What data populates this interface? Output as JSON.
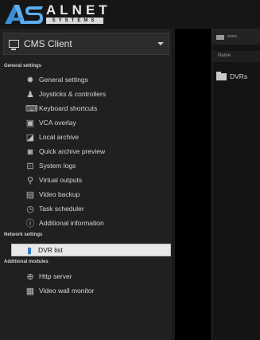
{
  "logo": {
    "brand": "ALNET",
    "subtitle": "SYSTEMS",
    "mark": "AS"
  },
  "client_selector": {
    "label": "CMS Client"
  },
  "sections": [
    {
      "title": "General settings"
    },
    {
      "title": "Network settings"
    },
    {
      "title": "Additional modules"
    }
  ],
  "general_items": [
    {
      "label": "General settings",
      "icon": "gear-icon"
    },
    {
      "label": "Joysticks & controllers",
      "icon": "joystick-icon"
    },
    {
      "label": "Keyboard shortcuts",
      "icon": "keyboard-icon"
    },
    {
      "label": "VCA overlay",
      "icon": "vca-icon"
    },
    {
      "label": "Local archive",
      "icon": "archive-icon"
    },
    {
      "label": "Quick archive preview",
      "icon": "preview-icon"
    },
    {
      "label": "System logs",
      "icon": "terminal-icon"
    },
    {
      "label": "Virtual outputs",
      "icon": "output-icon"
    },
    {
      "label": "Video backup",
      "icon": "backup-icon"
    },
    {
      "label": "Task scheduler",
      "icon": "clock-icon"
    },
    {
      "label": "Additional information",
      "icon": "info-icon"
    }
  ],
  "network_items": [
    {
      "label": "DVR list",
      "icon": "dvr-icon",
      "selected": true
    }
  ],
  "module_items": [
    {
      "label": "Http server",
      "icon": "globe-icon"
    },
    {
      "label": "Video wall monitor",
      "icon": "grid-icon"
    }
  ],
  "right_panel": {
    "breadcrumb": "DVRs",
    "column_name": "Name",
    "rows": [
      {
        "name": "DVRs"
      }
    ]
  }
}
